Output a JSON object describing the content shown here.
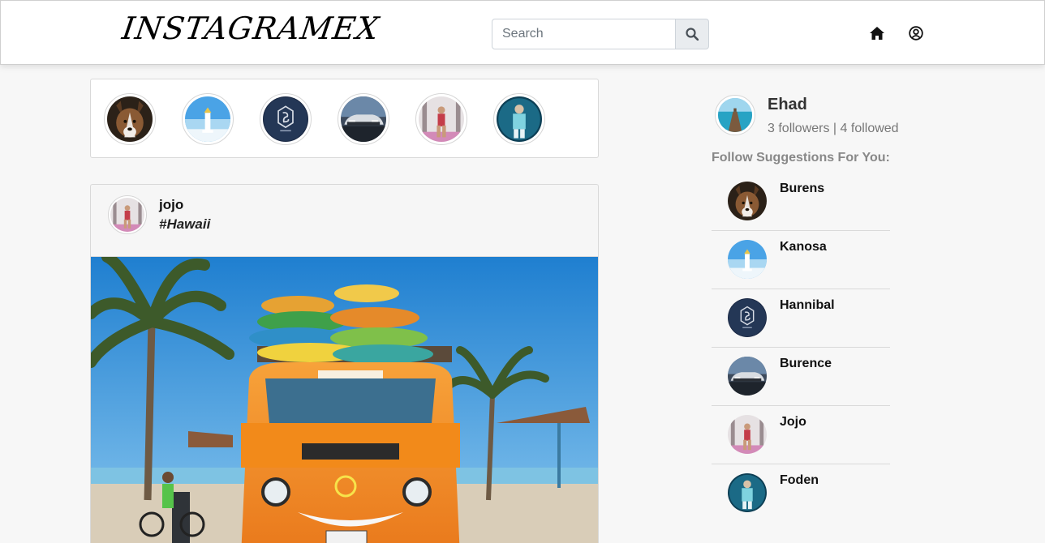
{
  "app": {
    "logo": "INSTAGRAMEX"
  },
  "search": {
    "placeholder": "Search",
    "button_icon": "search-icon"
  },
  "nav": {
    "home_icon": "home-icon",
    "profile_icon": "user-circle-icon"
  },
  "stories": [
    {
      "avatar": "husky"
    },
    {
      "avatar": "lighthouse"
    },
    {
      "avatar": "logo-badge"
    },
    {
      "avatar": "car"
    },
    {
      "avatar": "gym-woman"
    },
    {
      "avatar": "footballer"
    }
  ],
  "post": {
    "username": "jojo",
    "tag": "#Hawaii",
    "avatar": "gym-woman",
    "image": "orange-van-on-beach"
  },
  "profile": {
    "name": "Ehad",
    "stats": "3 followers | 4 followed",
    "avatar": "pier"
  },
  "suggestions": {
    "title": "Follow Suggestions For You:",
    "items": [
      {
        "name": "Burens",
        "avatar": "husky"
      },
      {
        "name": "Kanosa",
        "avatar": "lighthouse"
      },
      {
        "name": "Hannibal",
        "avatar": "logo-badge"
      },
      {
        "name": "Burence",
        "avatar": "car"
      },
      {
        "name": "Jojo",
        "avatar": "gym-woman"
      },
      {
        "name": "Foden",
        "avatar": "footballer"
      }
    ]
  },
  "colors": {
    "navbar_bg": "#ffffff",
    "page_bg": "#f7f7f7",
    "van": "#f28a1a",
    "sky": "#2f8fd8"
  }
}
